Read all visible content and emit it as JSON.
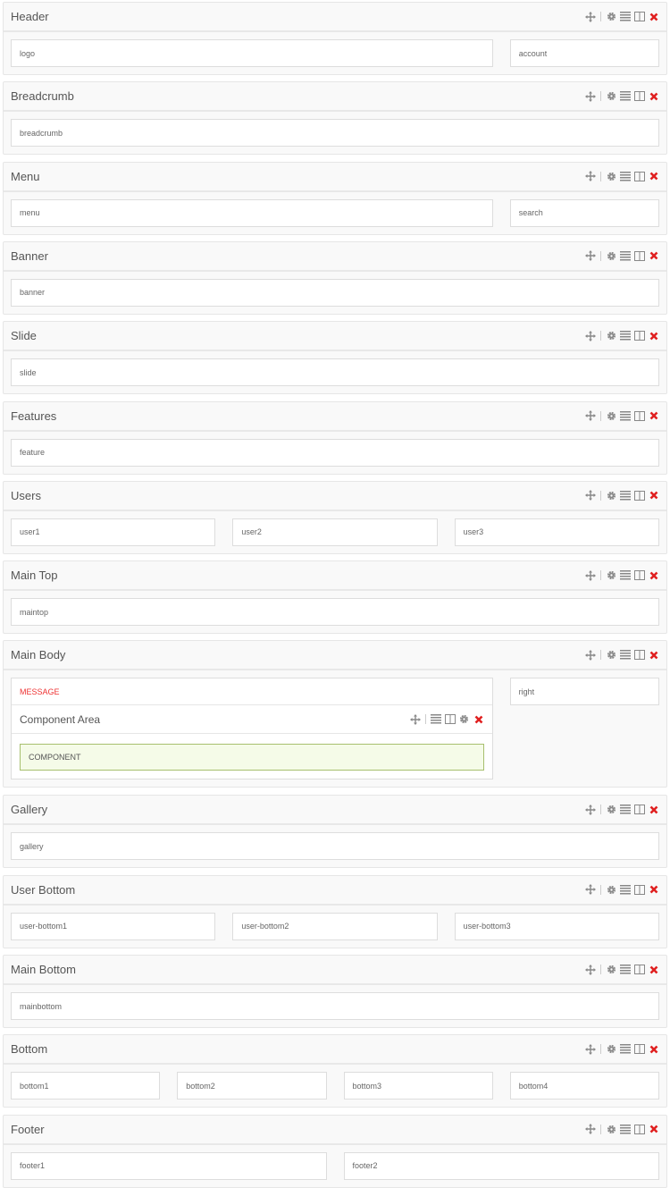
{
  "sections": [
    {
      "title": "Header",
      "columns": [
        {
          "label": "logo",
          "span": 9
        },
        {
          "label": "account",
          "span": 3
        }
      ]
    },
    {
      "title": "Breadcrumb",
      "columns": [
        {
          "label": "breadcrumb",
          "span": 12
        }
      ]
    },
    {
      "title": "Menu",
      "columns": [
        {
          "label": "menu",
          "span": 9
        },
        {
          "label": "search",
          "span": 3
        }
      ]
    },
    {
      "title": "Banner",
      "columns": [
        {
          "label": "banner",
          "span": 12
        }
      ]
    },
    {
      "title": "Slide",
      "columns": [
        {
          "label": "slide",
          "span": 12
        }
      ]
    },
    {
      "title": "Features",
      "columns": [
        {
          "label": "feature",
          "span": 12
        }
      ]
    },
    {
      "title": "Users",
      "columns": [
        {
          "label": "user1",
          "span": 4
        },
        {
          "label": "user2",
          "span": 4
        },
        {
          "label": "user3",
          "span": 4
        }
      ]
    },
    {
      "title": "Main Top",
      "columns": [
        {
          "label": "maintop",
          "span": 12
        }
      ]
    },
    {
      "title": "Main Body",
      "main_body": true,
      "message": "MESSAGE",
      "component_area": {
        "title": "Component Area",
        "component": "COMPONENT"
      },
      "columns": [
        {
          "label": "right",
          "span": 3
        }
      ]
    },
    {
      "title": "Gallery",
      "columns": [
        {
          "label": "gallery",
          "span": 12
        }
      ]
    },
    {
      "title": "User Bottom",
      "columns": [
        {
          "label": "user-bottom1",
          "span": 4
        },
        {
          "label": "user-bottom2",
          "span": 4
        },
        {
          "label": "user-bottom3",
          "span": 4
        }
      ]
    },
    {
      "title": "Main Bottom",
      "columns": [
        {
          "label": "mainbottom",
          "span": 12
        }
      ]
    },
    {
      "title": "Bottom",
      "columns": [
        {
          "label": "bottom1",
          "span": 3
        },
        {
          "label": "bottom2",
          "span": 3
        },
        {
          "label": "bottom3",
          "span": 3
        },
        {
          "label": "bottom4",
          "span": 3
        }
      ]
    },
    {
      "title": "Footer",
      "columns": [
        {
          "label": "footer1",
          "span": 6
        },
        {
          "label": "footer2",
          "span": 6
        }
      ]
    }
  ],
  "colors": {
    "delete": "#e02020",
    "icon": "#888888",
    "component_border": "#a7bf6e",
    "component_bg": "#f5fbe8",
    "message": "#ee3333"
  }
}
